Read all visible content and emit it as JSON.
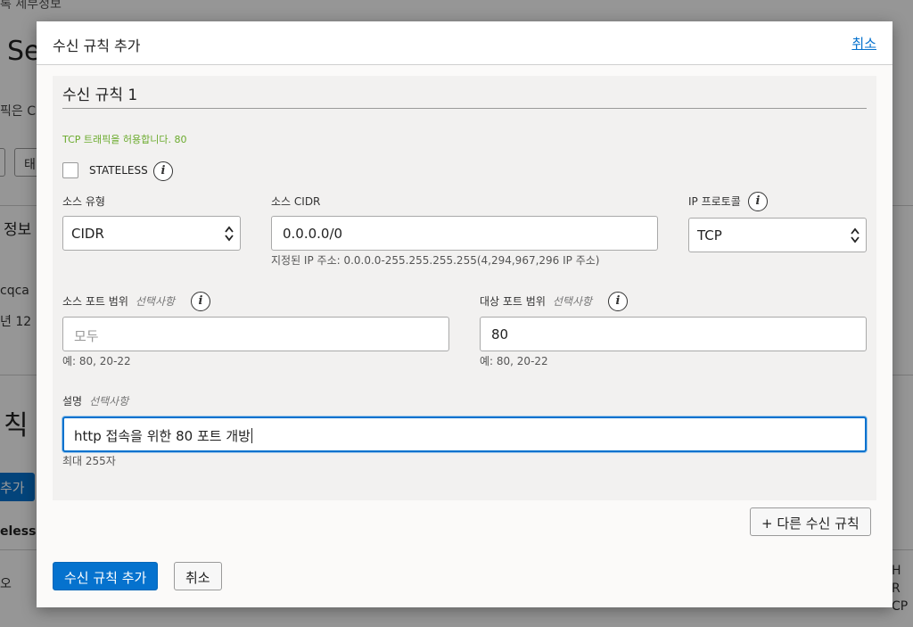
{
  "background": {
    "breadcrumb": "록 세부정보",
    "title": "Se",
    "text1": "픽은 C",
    "button_label": "태",
    "info_heading": "정보",
    "cqca": "cqca",
    "year": "년 12",
    "rules_heading": "칙",
    "add_button": "추가",
    "stateless_col": "eless",
    "row_text": "오",
    "right_text_1": "H R",
    "right_text_2": "CP"
  },
  "dialog": {
    "title": "수신 규칙 추가",
    "close_link": "취소",
    "rule": {
      "heading": "수신 규칙 1",
      "summary": "TCP 트래픽을 허용합니다. 80",
      "stateless_label": "STATELESS",
      "source_type_label": "소스 유형",
      "source_type_value": "CIDR",
      "source_cidr_label": "소스 CIDR",
      "source_cidr_value": "0.0.0.0/0",
      "source_cidr_hint": "지정된 IP 주소: 0.0.0.0-255.255.255.255(4,294,967,296 IP 주소)",
      "ip_protocol_label": "IP 프로토콜",
      "ip_protocol_value": "TCP",
      "src_port_label": "소스 포트 범위",
      "optional": "선택사항",
      "src_port_placeholder": "모두",
      "src_port_hint": "예: 80, 20-22",
      "dst_port_label": "대상 포트 범위",
      "dst_port_value": "80",
      "dst_port_hint": "예: 80, 20-22",
      "description_label": "설명",
      "description_value": "http 접속을 위한 80 포트 개방",
      "description_hint": "최대 255자"
    },
    "add_another_button": "+ 다른 수신 규칙",
    "submit_button": "수신 규칙 추가",
    "cancel_button": "취소"
  },
  "icons": {
    "info": "i"
  },
  "colors": {
    "primary": "#0572ce",
    "summary_green": "#6bab2d",
    "link": "#0572ce"
  }
}
